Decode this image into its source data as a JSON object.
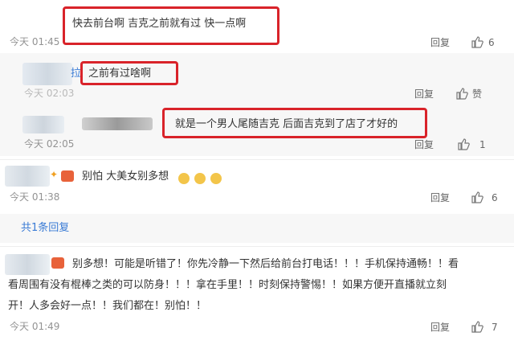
{
  "comments": [
    {
      "text": "快去前台啊 吉克之前就有过 快一点啊",
      "time": "今天 01:45",
      "reply_label": "回复",
      "likes": "6"
    },
    {
      "author_suffix": "拉",
      "text": "之前有过啥啊",
      "time": "今天 02:03",
      "reply_label": "回复",
      "like_label": "赞"
    },
    {
      "text": "就是一个男人尾随吉克 后面吉克到了店了才好的",
      "time": "今天 02:05",
      "reply_label": "回复",
      "likes": "1"
    },
    {
      "text": "别怕 大美女别多想",
      "time": "今天 01:38",
      "reply_label": "回复",
      "likes": "6"
    },
    {
      "line1": "别多想！可能是听错了！你先冷静一下然后给前台打电话！！！手机保持通畅！！看",
      "line2": "看周围有没有棍棒之类的可以防身！！！拿在手里！！时刻保持警惕！！如果方便开直播就立刻",
      "line3": "开！人多会好一点！！我们都在！别怕！！",
      "time": "今天 01:49",
      "reply_label": "回复",
      "likes": "7"
    }
  ],
  "replies_link": "共1条回复",
  "colors": {
    "highlight_box": "#d9232a",
    "link": "#3a7bd5",
    "meta": "#939393"
  }
}
